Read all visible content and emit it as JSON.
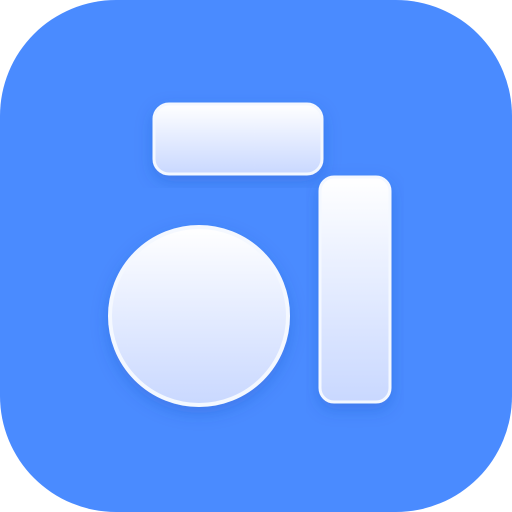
{
  "icon": {
    "name": "shapes-app-icon",
    "background_color": "#4a8bff",
    "shape_fill_top": "#ffffff",
    "shape_fill_bottom": "#c9d8ff",
    "shape_stroke": "#f4f8ff"
  }
}
